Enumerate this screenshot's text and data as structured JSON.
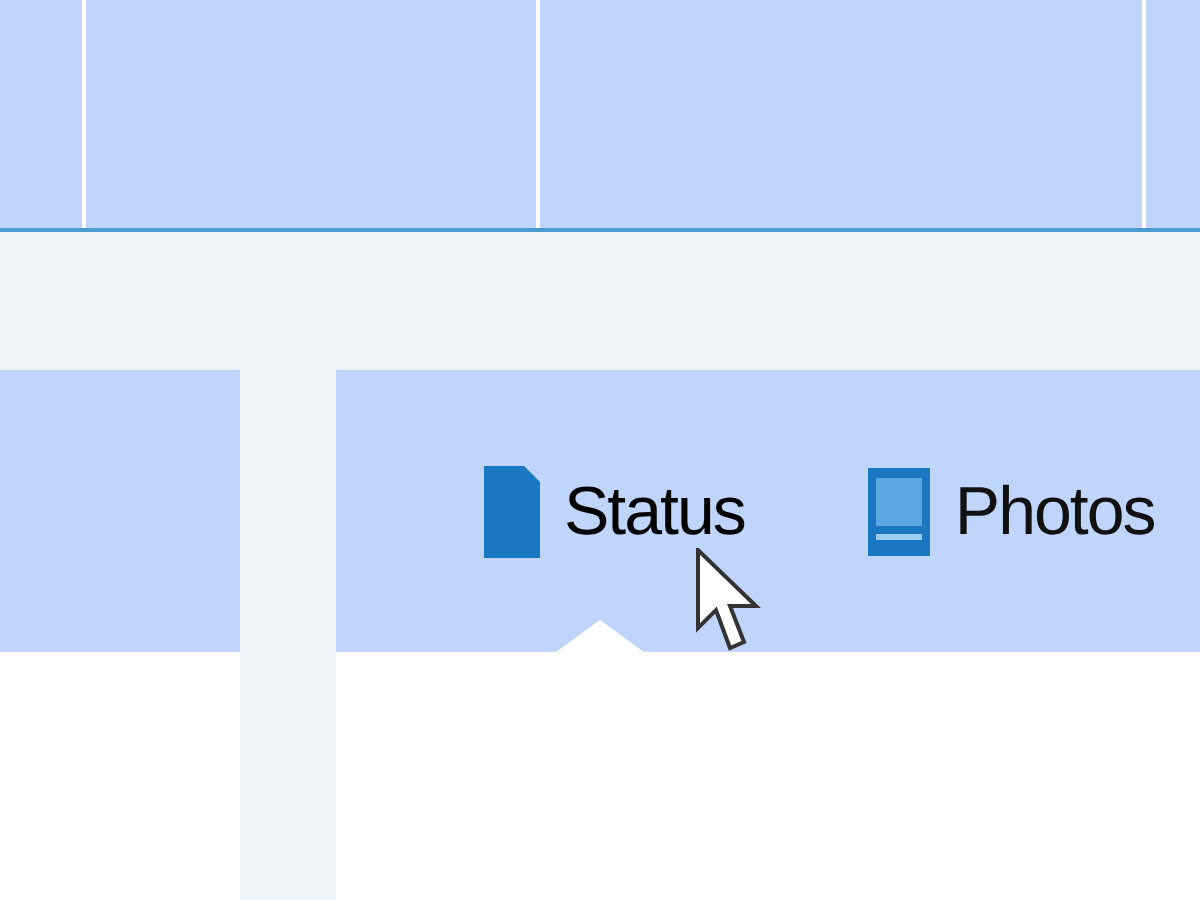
{
  "composer": {
    "tabs": [
      {
        "label": "Status",
        "selected": true,
        "kind": "status"
      },
      {
        "label": "Photos",
        "selected": false,
        "kind": "photos"
      }
    ]
  }
}
